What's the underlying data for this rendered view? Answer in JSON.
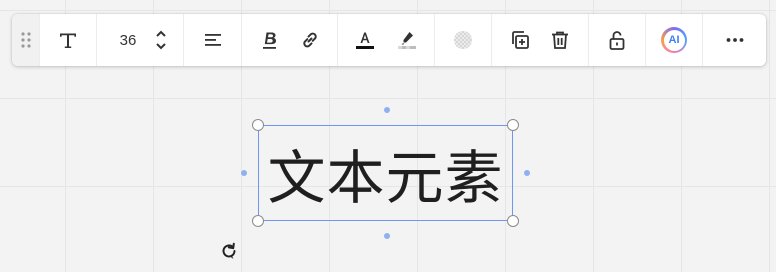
{
  "toolbar": {
    "font_size": "36",
    "ai_label": "AI"
  },
  "canvas": {
    "text_element": "文本元素"
  },
  "colors": {
    "selection": "#6f97ef",
    "text": "#1f1f1f",
    "text_color_swatch": "#111111"
  },
  "icons": [
    "drag-handle-icon",
    "text-type-icon",
    "chevron-up-icon",
    "chevron-down-icon",
    "align-left-icon",
    "bold-icon",
    "link-icon",
    "text-color-icon",
    "highlight-icon",
    "transparency-icon",
    "duplicate-icon",
    "delete-icon",
    "unlock-icon",
    "ai-icon",
    "more-icon",
    "rotate-icon"
  ]
}
